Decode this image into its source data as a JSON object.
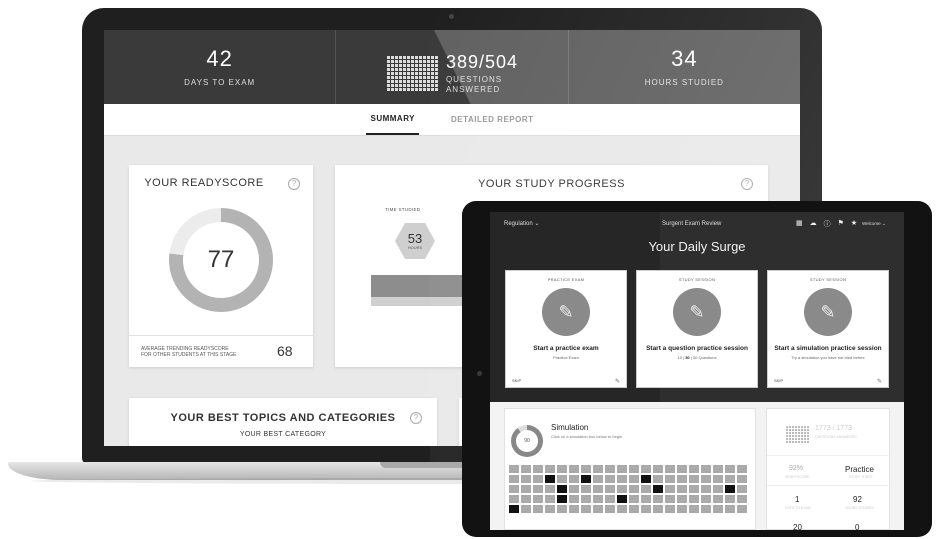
{
  "stats": [
    {
      "value": "42",
      "label": "DAYS TO EXAM"
    },
    {
      "value": "389/504",
      "label_line1": "QUESTIONS",
      "label_line2": "ANSWERED"
    },
    {
      "value": "34",
      "label": "HOURS STUDIED"
    }
  ],
  "tabs": [
    {
      "label": "SUMMARY",
      "active": true
    },
    {
      "label": "DETAILED REPORT",
      "active": false
    }
  ],
  "readyscore": {
    "title": "YOUR READYSCORE",
    "score": "77",
    "score_fraction": 0.77,
    "avg_label_line1": "AVERAGE TRENDING READYSCORE",
    "avg_label_line2": "FOR OTHER STUDENTS AT THIS STAGE",
    "avg_value": "68"
  },
  "progress": {
    "title": "YOUR STUDY PROGRESS",
    "time_label": "TIME STUDIED",
    "hours": "53",
    "hours_unit": "HOURS"
  },
  "best": {
    "title": "YOUR BEST TOPICS AND CATEGORIES",
    "subtitle": "YOUR BEST CATEGORY"
  },
  "help_glyph": "?",
  "tablet": {
    "nav_left": "Regulation",
    "nav_center": "Surgent Exam Review",
    "nav_right": "Welcome",
    "heading": "Your Daily Surge",
    "cards": [
      {
        "type": "PRACTICE EXAM",
        "main": "Start a practice exam",
        "sub": "Practice Exam",
        "skip": "SKIP"
      },
      {
        "type": "STUDY SESSION",
        "main": "Start a question practice session",
        "sub_parts": [
          "10",
          "30",
          "50",
          "Questions"
        ]
      },
      {
        "type": "STUDY SESSION",
        "main": "Start a simulation practice session",
        "sub": "Try a simulation you have not tried before",
        "skip": "SKIP"
      }
    ],
    "simulation": {
      "title": "Simulation",
      "sub": "Click on a simulation box below to begin",
      "ring_value": "90"
    },
    "side": {
      "count": "1773 / 1773",
      "count_label": "QUESTIONS ANSWERED",
      "pct": "92%",
      "pct_label": "READYSCORE",
      "practice": "Practice",
      "practice_label": "STUDY STATE",
      "v1": "1",
      "v1_label": "DAYS TO EXAM",
      "v2": "92",
      "v2_label": "HOURS STUDIED",
      "v3": "20",
      "v4": "0"
    }
  },
  "colors": {
    "dark_bar": "#3a3a3a",
    "accent": "#222222",
    "muted": "#b3b3b3"
  }
}
